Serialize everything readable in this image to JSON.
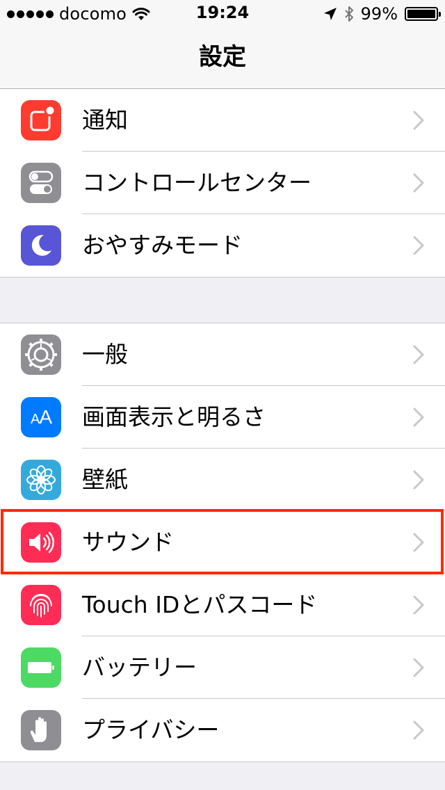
{
  "status_bar": {
    "carrier": "docomo",
    "time": "19:24",
    "battery_percent": "99%",
    "battery_level": 0.99
  },
  "nav": {
    "title": "設定"
  },
  "colors": {
    "notifications": "#fe3b30",
    "control_center": "#8e8e93",
    "do_not_disturb": "#5856d6",
    "general": "#8e8e93",
    "display": "#007aff",
    "wallpaper": "#34aadc",
    "sounds": "#ff2d55",
    "touch_id": "#ff2d55",
    "battery": "#4cd964",
    "privacy": "#8e8e93",
    "highlight": "#ff2a00"
  },
  "groups": [
    {
      "items": [
        {
          "label": "通知",
          "icon": "notifications-icon"
        },
        {
          "label": "コントロールセンター",
          "icon": "control-center-icon"
        },
        {
          "label": "おやすみモード",
          "icon": "moon-icon"
        }
      ]
    },
    {
      "items": [
        {
          "label": "一般",
          "icon": "gear-icon"
        },
        {
          "label": "画面表示と明るさ",
          "icon": "text-size-icon"
        },
        {
          "label": "壁紙",
          "icon": "flower-icon"
        },
        {
          "label": "サウンド",
          "icon": "speaker-icon"
        },
        {
          "label": "Touch IDとパスコード",
          "icon": "fingerprint-icon"
        },
        {
          "label": "バッテリー",
          "icon": "battery-icon"
        },
        {
          "label": "プライバシー",
          "icon": "hand-icon"
        }
      ]
    }
  ]
}
